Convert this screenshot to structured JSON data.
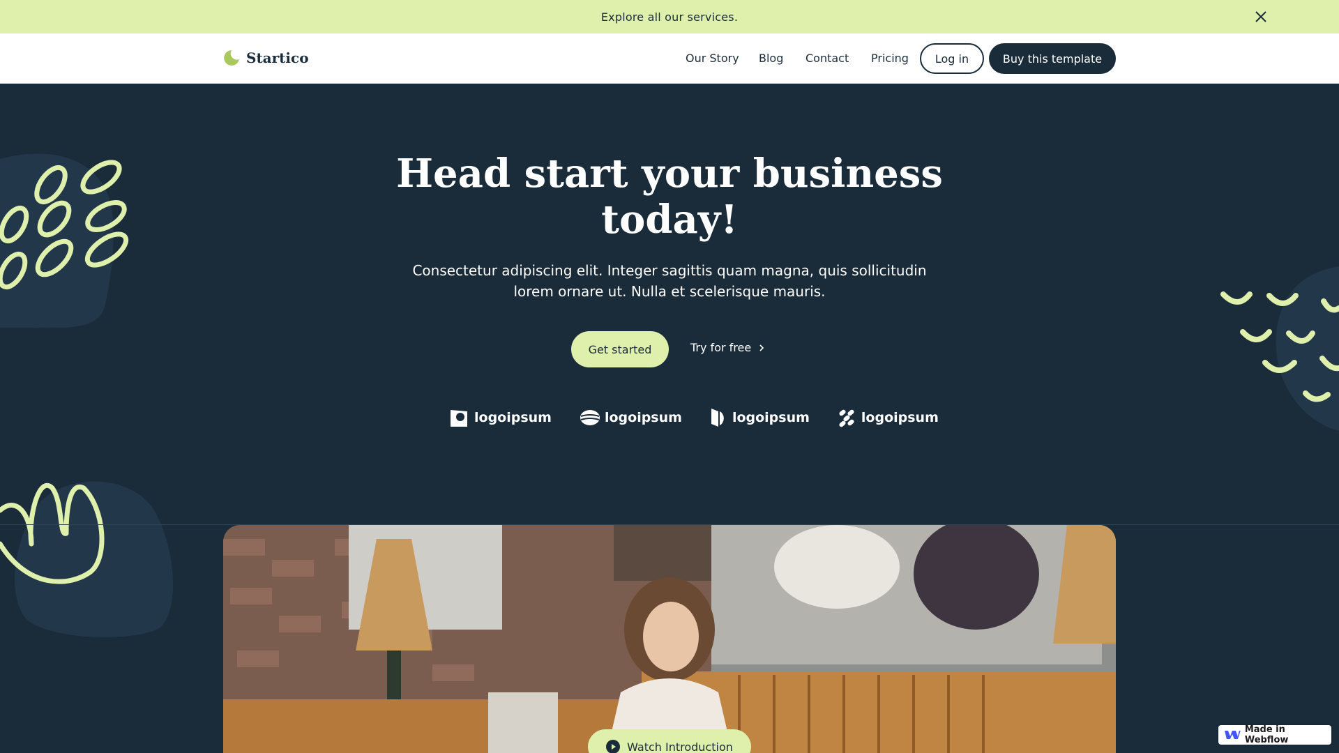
{
  "banner": {
    "text": "Explore all our services.",
    "close_icon": "close-icon"
  },
  "nav": {
    "brand": "Startico",
    "links": [
      "Our Story",
      "Blog",
      "Contact",
      "Pricing"
    ],
    "login": "Log in",
    "cta": "Buy this template"
  },
  "hero": {
    "title": "Head start your business today!",
    "subtitle": "Consectetur adipiscing elit. Integer sagittis quam magna, quis sollicitudin lorem ornare ut. Nulla et scelerisque mauris.",
    "primary_cta": "Get started",
    "secondary_cta": "Try for free"
  },
  "logos": [
    "logoipsum",
    "logoipsum",
    "logoipsum",
    "logoipsum"
  ],
  "video": {
    "button": "Watch Introduction"
  },
  "badge": {
    "text": "Made in Webflow"
  },
  "colors": {
    "navy": "#1a2b3a",
    "lime": "#dff0ad",
    "blob": "#22384a"
  }
}
